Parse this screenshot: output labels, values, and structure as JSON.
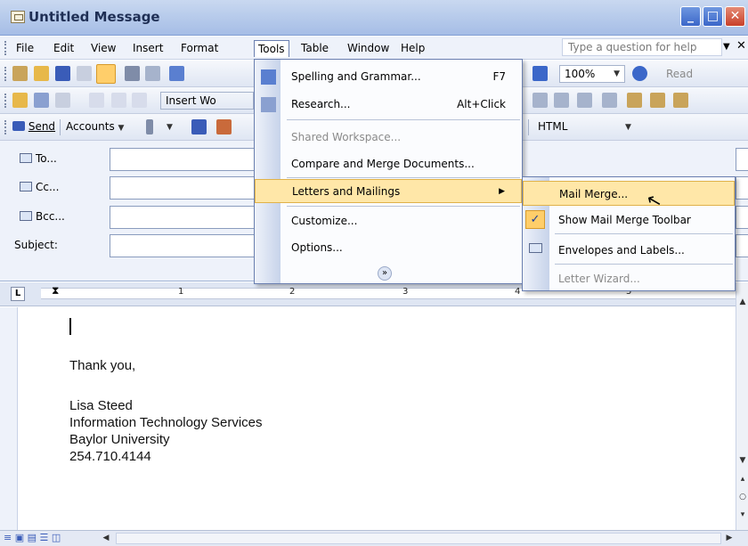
{
  "window": {
    "title": "Untitled Message",
    "minimize": "_",
    "maximize": "□",
    "close": "✕"
  },
  "menubar": {
    "items": [
      "File",
      "Edit",
      "View",
      "Insert",
      "Format",
      "Tools",
      "Table",
      "Window",
      "Help"
    ],
    "active": "Tools",
    "help_placeholder": "Type a question for help"
  },
  "toolbar_standard": {
    "zoom": "100%",
    "read_label": "Read"
  },
  "toolbar_mail": {
    "insert_label": "Insert Wo"
  },
  "toolbar_email": {
    "send_label": "Send",
    "accounts_label": "Accounts",
    "format_value": "HTML"
  },
  "header_fields": {
    "to_label": "To...",
    "cc_label": "Cc...",
    "bcc_label": "Bcc...",
    "subject_label": "Subject:"
  },
  "ruler": {
    "tab_glyph": "L",
    "numbers": [
      "1",
      "2",
      "3",
      "4",
      "5"
    ]
  },
  "document": {
    "lines": [
      "Thank you,",
      "Lisa Steed",
      "Information Technology Services",
      "Baylor University",
      "254.710.4144"
    ]
  },
  "tools_menu": {
    "items": [
      {
        "label": "Spelling and Grammar...",
        "shortcut": "F7",
        "icon": "spelling-icon"
      },
      {
        "label": "Research...",
        "shortcut": "Alt+Click",
        "icon": "research-icon"
      },
      {
        "label": "Shared Workspace...",
        "disabled": true
      },
      {
        "label": "Compare and Merge Documents..."
      },
      {
        "label": "Letters and Mailings",
        "submenu": true,
        "highlighted": true
      },
      {
        "label": "Customize..."
      },
      {
        "label": "Options..."
      }
    ],
    "expand_glyph": "»"
  },
  "letters_submenu": {
    "items": [
      {
        "label": "Mail Merge...",
        "highlighted": true
      },
      {
        "label": "Show Mail Merge Toolbar",
        "checked": true
      },
      {
        "label": "Envelopes and Labels...",
        "icon": "envelope-icon"
      },
      {
        "label": "Letter Wizard...",
        "disabled": true
      }
    ]
  },
  "colors": {
    "highlight": "#ffe7a8",
    "titlebar": "#b3c8ea",
    "menubar": "#eef2fa"
  }
}
